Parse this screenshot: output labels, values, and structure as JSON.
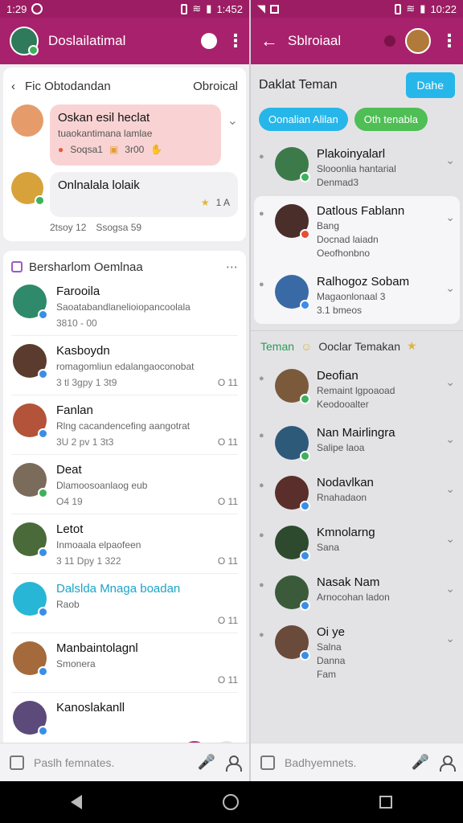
{
  "status_left": {
    "time": "1:29",
    "right_time": "1:452"
  },
  "status_right": {
    "time": "10:22"
  },
  "left": {
    "title": "Doslailatimal",
    "recent": {
      "back_label": "Fic Obtodandan",
      "right_label": "Obroical",
      "items": [
        {
          "name": "Oskan esil heclat",
          "sub": "tuaokantimana lamlae",
          "meta1": "Soqsa1",
          "meta2": "3r00"
        },
        {
          "name": "Onlnalala lolaik",
          "meta": "1 A"
        }
      ],
      "under_meta1": "2tsoy 12",
      "under_meta2": "Ssogsa 59"
    },
    "contacts": {
      "title": "Bersharlom Oemlnaa",
      "items": [
        {
          "name": "Farooila",
          "sub": "Saoatabandlanelioiopancoolala",
          "date": "3810 - 00",
          "time": "",
          "color": "#2e8a6a",
          "initial": "F",
          "badge": ""
        },
        {
          "name": "Kasboydn",
          "sub": "romagomliun edalangaoconobat",
          "date": "3 tl 3gpy 1 3t9",
          "time": "O 11",
          "color": "#5a3b2e",
          "initial": "K",
          "badge": ""
        },
        {
          "name": "Fanlan",
          "sub": "Rlng cacandencefing aangotrat",
          "date": "3U 2 pv 1 3t3",
          "time": "O 11",
          "color": "#b3533a",
          "initial": "F",
          "badge": ""
        },
        {
          "name": "Deat",
          "sub": "Dlamoosoanlaog eub",
          "date": "O4 19",
          "time": "O 11",
          "color": "#7b6b5b",
          "initial": "D",
          "badge": "green"
        },
        {
          "name": "Letot",
          "sub": "Inmoaala elpaofeen",
          "date": "3 11 Dpy 1 322",
          "time": "O 11",
          "color": "#4b6a3a",
          "initial": "L",
          "badge": ""
        },
        {
          "name": "Dalslda Mnaga boadan",
          "sub": "Raob",
          "date": "",
          "time": "O 11",
          "color": "#28b6d6",
          "initial": "D",
          "badge": ""
        },
        {
          "name": "Manbaintolagnl",
          "sub": "Smonera",
          "date": "",
          "time": "O 11",
          "color": "#a56a3b",
          "initial": "M",
          "badge": ""
        },
        {
          "name": "Kanoslakanll",
          "sub": "",
          "date": "",
          "time": "",
          "color": "#5b4a7a",
          "initial": "K",
          "badge": ""
        }
      ]
    },
    "input_placeholder": "Paslh femnates."
  },
  "right": {
    "title": "Sblroiaal",
    "header_title": "Daklat Teman",
    "primary_button": "Dahe",
    "chip_blue": "Oonalian Alilan",
    "chip_green": "Oth tenabla",
    "list_top": [
      {
        "name": "Plakoinyalarl",
        "sub": "Slooonlia hantarial",
        "sub2": "Denmad3",
        "color": "#3c7a4a",
        "badge": "green"
      }
    ],
    "list_panel": [
      {
        "name": "Datlous Fablann",
        "sub": "Bang",
        "sub2": "Docnad laiadn",
        "sub3": "Oeofhonbno",
        "color": "#4a2e2a",
        "badge": "red"
      },
      {
        "name": "Ralhogoz Sobam",
        "sub": "Magaonlonaal 3",
        "sub2": "3.1 bmeos",
        "color": "#3a6aa5",
        "badge": ""
      }
    ],
    "section": {
      "label": "Teman",
      "title": "Ooclar Temakan"
    },
    "list_bottom": [
      {
        "name": "Deofian",
        "sub": "Remaint lgpoaoad",
        "sub2": "Keodooalter",
        "color": "#7a5a3a",
        "badge": "green"
      },
      {
        "name": "Nan Mairlingra",
        "sub": "Salipe laoa",
        "color": "#2e5a7a",
        "badge": "green"
      },
      {
        "name": "Nodavlkan",
        "sub": "Rnahadaon",
        "color": "#5a2e2a",
        "badge": ""
      },
      {
        "name": "Kmnolarng",
        "sub": "Sana",
        "color": "#2e4a2e",
        "badge": ""
      },
      {
        "name": "Nasak Nam",
        "sub": "Arnocohan ladon",
        "color": "#3a5a3a",
        "badge": ""
      },
      {
        "name": "Oi ye",
        "sub": "Salna",
        "sub_mid": "Danna",
        "sub_end": "Fam",
        "color": "#6a4a3a",
        "badge": ""
      }
    ],
    "input_placeholder": "Badhyemnets."
  }
}
